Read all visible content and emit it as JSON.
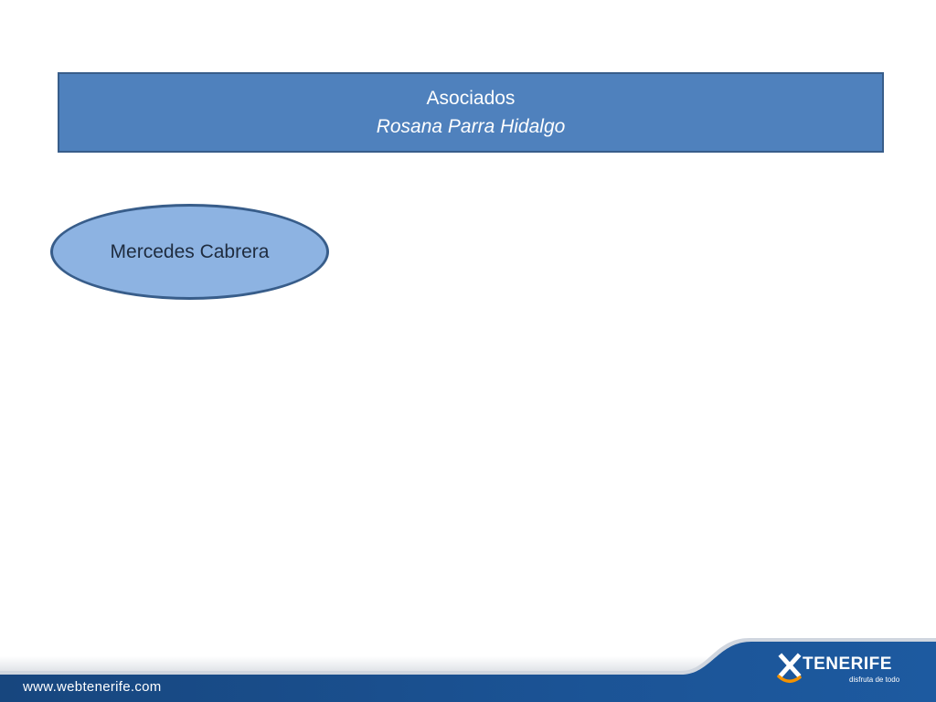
{
  "header": {
    "title": "Asociados",
    "subtitle": "Rosana Parra Hidalgo"
  },
  "members": [
    {
      "name": "Mercedes Cabrera"
    }
  ],
  "footer": {
    "url": "www.webtenerife.com",
    "logo": {
      "brand": "TENERIFE",
      "tagline": "disfruta de todo",
      "icon": "x-smile-logo-icon"
    }
  },
  "colors": {
    "header_fill": "#4f81bd",
    "header_border": "#385d8a",
    "oval_fill": "#8db3e2",
    "footer_blue": "#1a4f8c",
    "logo_accent": "#f39200"
  }
}
